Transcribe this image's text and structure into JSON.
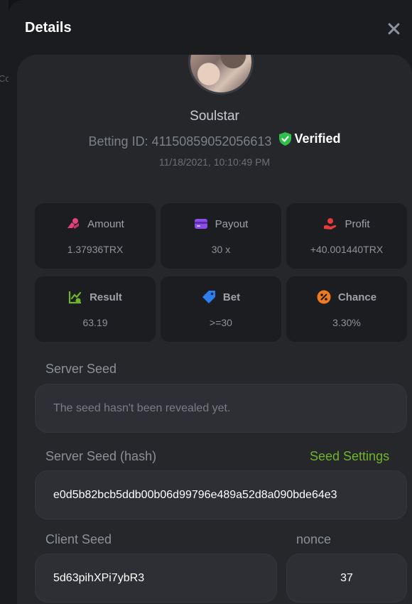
{
  "background": {
    "partial_text": "Co"
  },
  "modal": {
    "title": "Details"
  },
  "player": {
    "name": "Soulstar",
    "betting_id_label": "Betting ID: 41150859052056613",
    "verified_label": "Verified",
    "timestamp": "11/18/2021, 10:10:49 PM"
  },
  "stats": [
    {
      "label": "Amount",
      "value": "1.37936TRX",
      "icon": "coins-icon",
      "color": "#e5427a"
    },
    {
      "label": "Payout",
      "value": "30 x",
      "icon": "card-icon",
      "color": "#8b4de8"
    },
    {
      "label": "Profit",
      "value": "+40.001440TRX",
      "icon": "hand-money-icon",
      "color": "#e53b3b"
    },
    {
      "label": "Result",
      "value": "63.19",
      "icon": "chart-check-icon",
      "color": "#6fb52c"
    },
    {
      "label": "Bet",
      "value": ">=30",
      "icon": "tag-icon",
      "color": "#2f7ef0"
    },
    {
      "label": "Chance",
      "value": "3.30%",
      "icon": "percent-icon",
      "color": "#f07a1f"
    }
  ],
  "server_seed": {
    "label": "Server Seed",
    "value": "The seed hasn't been revealed yet."
  },
  "server_seed_hash": {
    "label": "Server Seed (hash)",
    "settings_link": "Seed Settings",
    "value": "e0d5b82bcb5ddb00b06d99796e489a52d8a090bde64e3"
  },
  "client_seed": {
    "label": "Client Seed",
    "value": "5d63pihXPi7ybR3"
  },
  "nonce": {
    "label": "nonce",
    "value": "37"
  },
  "colors": {
    "accent_green": "#6fb52c",
    "panel": "#25272b",
    "card": "#1c1d21"
  }
}
